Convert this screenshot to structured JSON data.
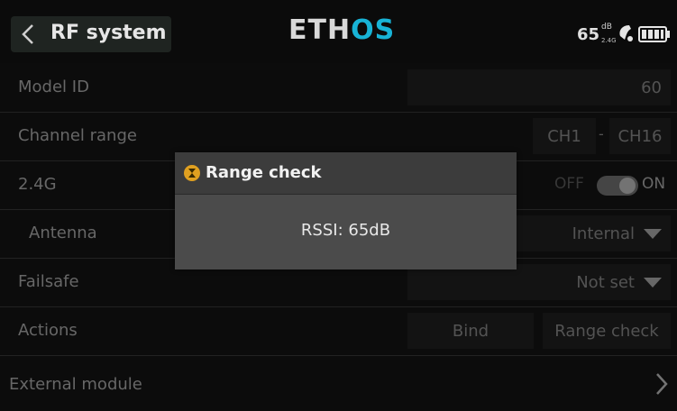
{
  "header": {
    "title": "RF system",
    "logo_main": "ETH",
    "logo_accent": "OS",
    "rssi_value": "65",
    "rssi_unit": "dB",
    "rssi_band": "2.4G",
    "icons": [
      "back-chevron-icon",
      "antenna-icon",
      "battery-icon"
    ]
  },
  "rows": {
    "model_id": {
      "label": "Model ID",
      "value": "60"
    },
    "channel_range": {
      "label": "Channel range",
      "from": "CH1",
      "separator": "-",
      "to": "CH16"
    },
    "band_24g": {
      "label": "2.4G",
      "off_label": "OFF",
      "on_label": "ON",
      "state": "on"
    },
    "antenna": {
      "label": "Antenna",
      "value": "Internal"
    },
    "failsafe": {
      "label": "Failsafe",
      "value": "Not set"
    },
    "actions": {
      "label": "Actions",
      "bind_label": "Bind",
      "range_check_label": "Range check"
    },
    "external_module": {
      "label": "External module"
    }
  },
  "dialog": {
    "title": "Range check",
    "message": "RSSI: 65dB",
    "icon": "hourglass-icon"
  },
  "colors": {
    "accent": "#18b3d6",
    "dialog_icon": "#e0a020"
  }
}
